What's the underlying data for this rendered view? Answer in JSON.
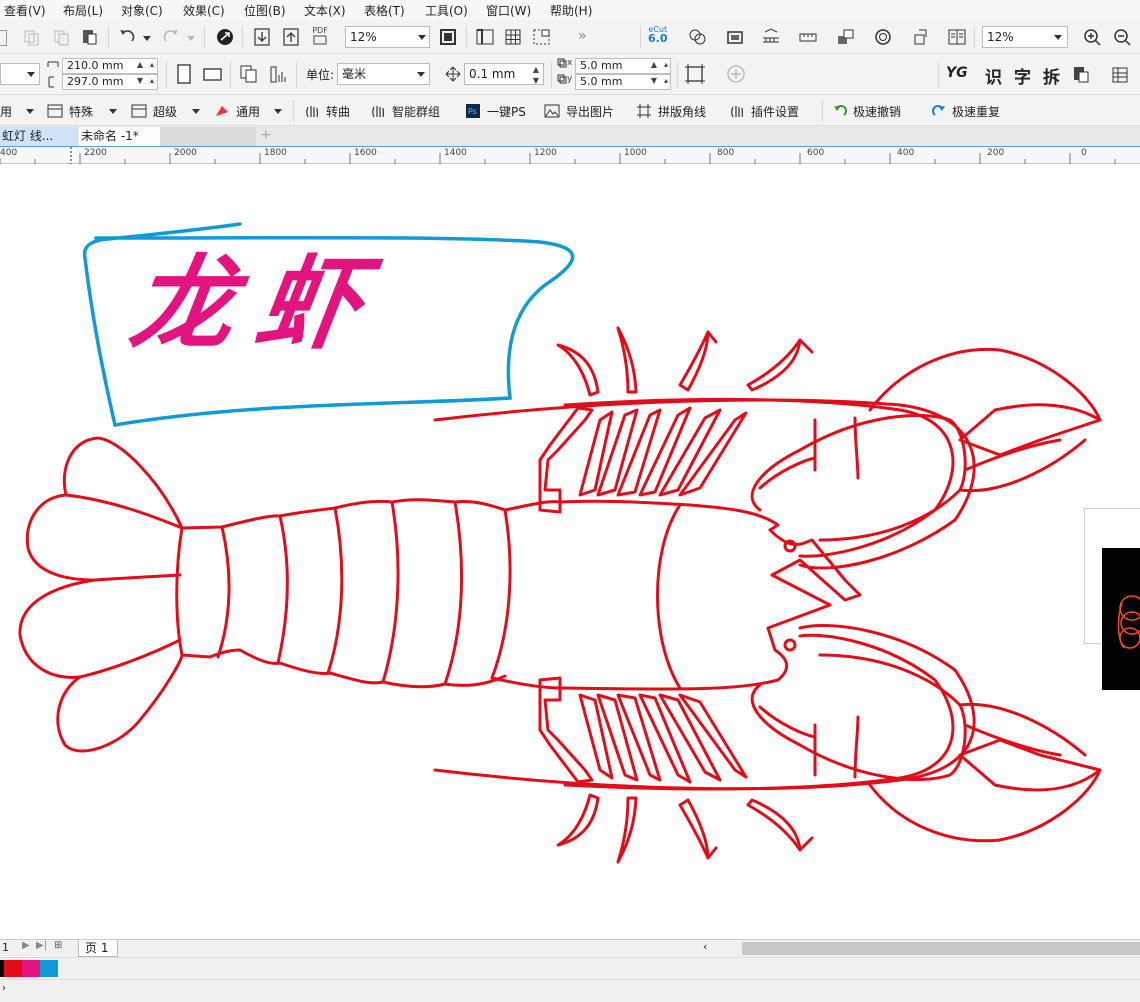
{
  "menu": [
    "查看(V)",
    "布局(L)",
    "对象(C)",
    "效果(C)",
    "位图(B)",
    "文本(X)",
    "表格(T)",
    "工具(O)",
    "窗口(W)",
    "帮助(H)"
  ],
  "toolbar1": {
    "zoom_left": "12%",
    "zoom_right": "12%",
    "pdf_label": "PDF",
    "ecut_top": "eCut",
    "ecut_ver": "6.0"
  },
  "toolbar2": {
    "width": "210.0 mm",
    "height": "297.0 mm",
    "unit_label": "单位:",
    "unit_value": "毫米",
    "nudge": "0.1 mm",
    "dup_x": "5.0 mm",
    "dup_y": "5.0 mm",
    "dup_x_prefix": "x",
    "dup_y_prefix": "y",
    "yg": "YG",
    "chars": [
      "识",
      "字",
      "拆"
    ]
  },
  "toolbar3": {
    "item0": "用",
    "item1": "特殊",
    "item2": "超级",
    "item3": "通用",
    "zhuanqu": "转曲",
    "group": "智能群组",
    "ps": "一键PS",
    "export": "导出图片",
    "corner": "拼版角线",
    "plugin": "插件设置",
    "undo": "极速撤销",
    "redo": "极速重复"
  },
  "tabs": [
    "虹灯 线...",
    "未命名 -1*"
  ],
  "ruler": [
    "400",
    "2200",
    "2000",
    "1800",
    "1600",
    "1400",
    "1200",
    "1000",
    "800",
    "600",
    "400",
    "200",
    "0"
  ],
  "artwork": {
    "title": "龙虾"
  },
  "page": {
    "counter": "1",
    "tab": "页 1"
  },
  "colors": {
    "stroke_red": "#e30d1a",
    "banner_blue": "#109ad8",
    "title_pink": "#e3147f"
  },
  "palette": [
    "#000000",
    "#e30d1a",
    "#e3147f",
    "#109ad8"
  ]
}
